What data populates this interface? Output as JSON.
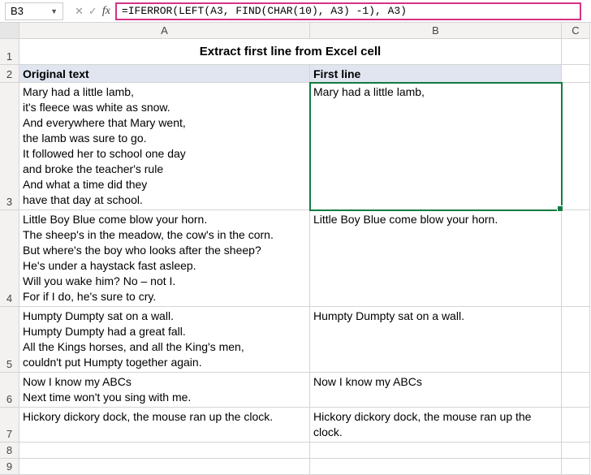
{
  "formula_bar": {
    "cell_ref": "B3",
    "cancel_symbol": "✕",
    "enter_symbol": "✓",
    "fx_label": "fx",
    "formula": "=IFERROR(LEFT(A3, FIND(CHAR(10), A3) -1), A3)"
  },
  "columns": {
    "a": "A",
    "b": "B",
    "c": "C"
  },
  "row_nums": {
    "r1": "1",
    "r2": "2",
    "r3": "3",
    "r4": "4",
    "r5": "5",
    "r6": "6",
    "r7": "7",
    "r8": "8",
    "r9": "9"
  },
  "title": "Extract first line from Excel cell",
  "headers": {
    "a": "Original text",
    "b": "First line"
  },
  "rows": {
    "r3": {
      "a": "Mary had a little lamb,\nit's fleece was white as snow.\nAnd everywhere that Mary went,\nthe lamb was sure to go.\nIt followed her to school one day\nand broke the teacher's rule\nAnd what a time did they\nhave that day at school.",
      "b": "Mary had a little lamb,"
    },
    "r4": {
      "a": "Little Boy Blue come blow your horn.\nThe sheep's in the meadow, the cow's in the corn.\nBut where's the boy who looks after the sheep?\nHe's under a haystack fast asleep.\nWill you wake him? No – not I.\nFor if I do, he's sure to cry.",
      "b": "Little Boy Blue come blow your horn."
    },
    "r5": {
      "a": "Humpty Dumpty sat on a wall.\nHumpty Dumpty had a great fall.\nAll the Kings horses, and all the King's men,\ncouldn't put Humpty together again.",
      "b": "Humpty Dumpty sat on a wall."
    },
    "r6": {
      "a": "Now I know my ABCs\nNext time won't you sing with me.",
      "b": "Now I know my ABCs"
    },
    "r7": {
      "a": "Hickory dickory dock, the mouse ran up the clock.",
      "b": "Hickory dickory dock, the mouse ran up the clock."
    }
  }
}
